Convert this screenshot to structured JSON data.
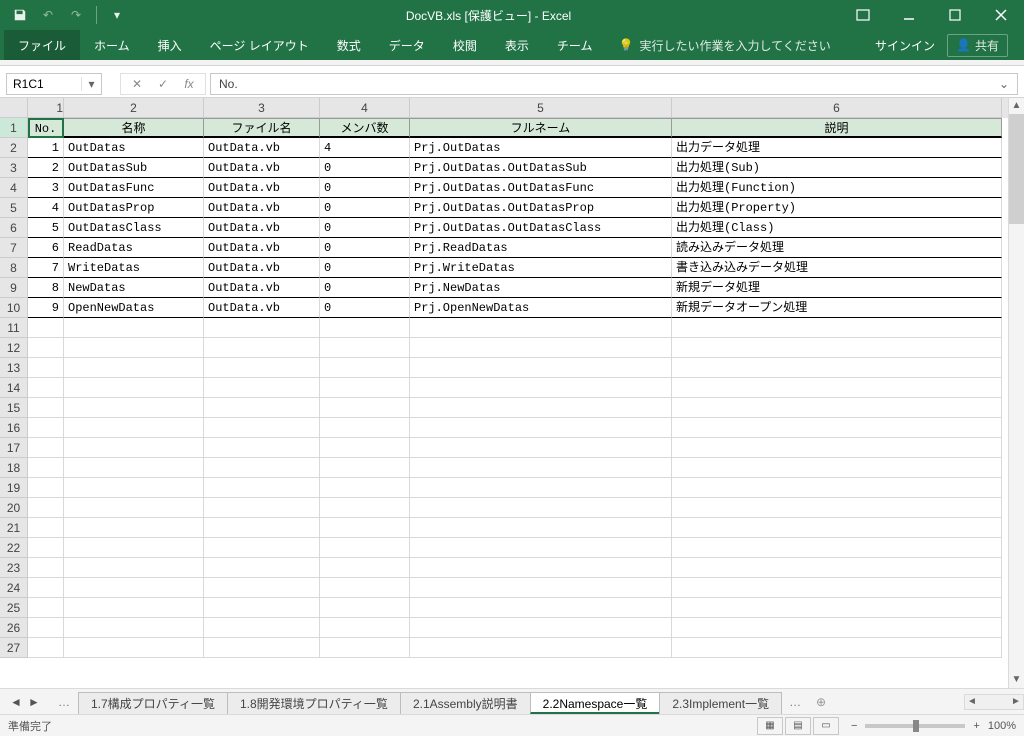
{
  "title": "DocVB.xls  [保護ビュー] - Excel",
  "qat": {
    "undo": "↶",
    "redo": "↷"
  },
  "tabs": {
    "file": "ファイル",
    "home": "ホーム",
    "insert": "挿入",
    "pagelayout": "ページ レイアウト",
    "formulas": "数式",
    "data": "データ",
    "review": "校閲",
    "view": "表示",
    "team": "チーム"
  },
  "tell_me": "実行したい作業を入力してください",
  "signin": "サインイン",
  "share": "共有",
  "name_box": "R1C1",
  "formula_value": "No.",
  "col_headers": [
    "1",
    "2",
    "3",
    "4",
    "5",
    "6"
  ],
  "headers": {
    "no": "No.",
    "name": "名称",
    "file": "ファイル名",
    "members": "メンバ数",
    "fullname": "フルネーム",
    "desc": "説明"
  },
  "rows": [
    {
      "no": "1",
      "name": "OutDatas",
      "file": "OutData.vb",
      "members": "4",
      "fullname": "Prj.OutDatas",
      "desc": "出力データ処理"
    },
    {
      "no": "2",
      "name": "OutDatasSub",
      "file": "OutData.vb",
      "members": "0",
      "fullname": "Prj.OutDatas.OutDatasSub",
      "desc": "出力処理(Sub)"
    },
    {
      "no": "3",
      "name": "OutDatasFunc",
      "file": "OutData.vb",
      "members": "0",
      "fullname": "Prj.OutDatas.OutDatasFunc",
      "desc": "出力処理(Function)"
    },
    {
      "no": "4",
      "name": "OutDatasProp",
      "file": "OutData.vb",
      "members": "0",
      "fullname": "Prj.OutDatas.OutDatasProp",
      "desc": "出力処理(Property)"
    },
    {
      "no": "5",
      "name": "OutDatasClass",
      "file": "OutData.vb",
      "members": "0",
      "fullname": "Prj.OutDatas.OutDatasClass",
      "desc": "出力処理(Class)"
    },
    {
      "no": "6",
      "name": "ReadDatas",
      "file": "OutData.vb",
      "members": "0",
      "fullname": "Prj.ReadDatas",
      "desc": "読み込みデータ処理"
    },
    {
      "no": "7",
      "name": "WriteDatas",
      "file": "OutData.vb",
      "members": "0",
      "fullname": "Prj.WriteDatas",
      "desc": "書き込み込みデータ処理"
    },
    {
      "no": "8",
      "name": "NewDatas",
      "file": "OutData.vb",
      "members": "0",
      "fullname": "Prj.NewDatas",
      "desc": "新規データ処理"
    },
    {
      "no": "9",
      "name": "OpenNewDatas",
      "file": "OutData.vb",
      "members": "0",
      "fullname": "Prj.OpenNewDatas",
      "desc": "新規データオープン処理"
    }
  ],
  "empty_row_count": 17,
  "sheet_tabs": [
    {
      "label": "1.7構成プロパティ一覧",
      "active": false
    },
    {
      "label": "1.8開発環境プロパティ一覧",
      "active": false
    },
    {
      "label": "2.1Assembly説明書",
      "active": false
    },
    {
      "label": "2.2Namespace一覧",
      "active": true
    },
    {
      "label": "2.3Implement一覧",
      "active": false
    }
  ],
  "status": "準備完了",
  "zoom": "100%"
}
